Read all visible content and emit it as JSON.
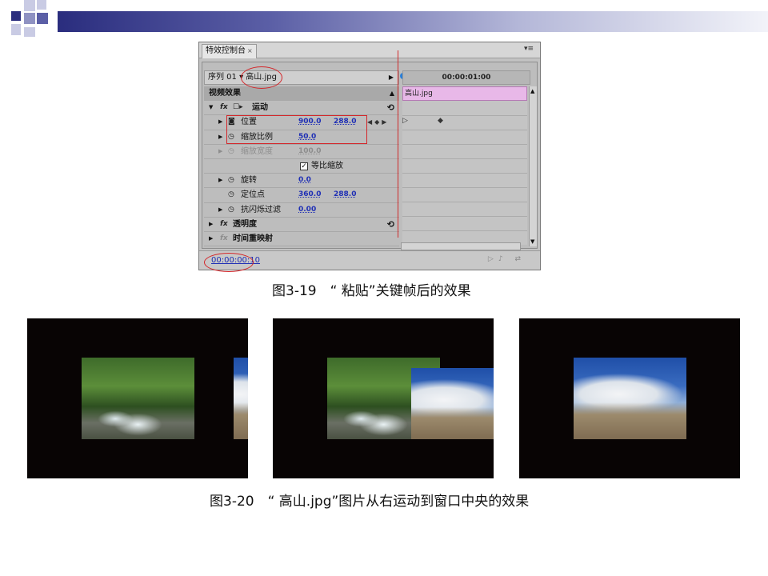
{
  "panel": {
    "tab_title": "特效控制台",
    "tab_close": "×",
    "panel_menu": "▾≡",
    "sequence": "序列 01 ▾ 高山.jpg",
    "timecode_top": "00:00:01:00",
    "clip_name": "高山.jpg",
    "video_effects_header": "视频效果",
    "motion": {
      "label": "运动",
      "position": {
        "label": "位置",
        "x": "900.0",
        "y": "288.0"
      },
      "scale": {
        "label": "缩放比例",
        "value": "50.0"
      },
      "scale_width": {
        "label": "缩放宽度",
        "value": "100.0"
      },
      "uniform_scale": {
        "label": "等比缩放",
        "checked": true
      },
      "rotation": {
        "label": "旋转",
        "value": "0.0"
      },
      "anchor": {
        "label": "定位点",
        "x": "360.0",
        "y": "288.0"
      },
      "antiflicker": {
        "label": "抗闪烁过滤",
        "value": "0.00"
      }
    },
    "opacity": {
      "label": "透明度"
    },
    "time_remap": {
      "label": "时间重映射"
    },
    "timecode_bottom": "00:00:00:10",
    "highlight_color": "#d4262a"
  },
  "captions": {
    "fig_19": "图3-19　“ 粘贴”关键帧后的效果",
    "fig_20": "图3-20　“ 高山.jpg”图片从右运动到窗口中央的效果"
  }
}
